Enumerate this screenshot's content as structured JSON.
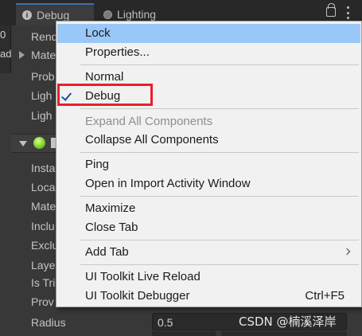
{
  "tabs": [
    {
      "label": "Debug",
      "icon": "info-icon"
    },
    {
      "label": "Lighting",
      "icon": "bulb-icon"
    }
  ],
  "left_strip": [
    "0",
    "ad"
  ],
  "background_labels": {
    "top": [
      "Rend",
      "Mate",
      "Prob",
      "Ligh",
      "Ligh"
    ],
    "bottom": [
      "Insta",
      "Loca",
      "Mate",
      "Inclu",
      "Exclu",
      "Laye",
      "Is Tri",
      "Prov",
      "Radius"
    ]
  },
  "radius_value": "0.5",
  "menu": {
    "items": {
      "lock": "Lock",
      "properties": "Properties...",
      "normal": "Normal",
      "debug": "Debug",
      "expand_all": "Expand All Components",
      "collapse_all": "Collapse All Components",
      "ping": "Ping",
      "open_import": "Open in Import Activity Window",
      "maximize": "Maximize",
      "close_tab": "Close Tab",
      "add_tab": "Add Tab",
      "ui_live_reload": "UI Toolkit Live Reload",
      "ui_debugger": "UI Toolkit Debugger"
    },
    "shortcut_ui_debugger": "Ctrl+F5",
    "highlight_color": "#99c8f8"
  },
  "annotation_color": "#e8202a",
  "watermark": "CSDN @楠溪泽岸"
}
